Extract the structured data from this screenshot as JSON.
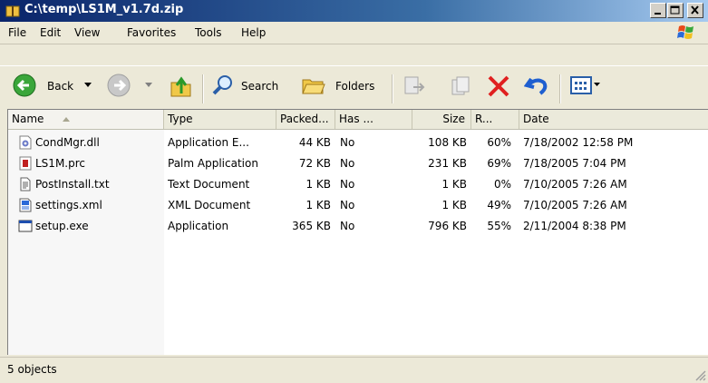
{
  "window": {
    "title": "C:\\temp\\LS1M_v1.7d.zip"
  },
  "menu": [
    "File",
    "Edit",
    "View",
    "Favorites",
    "Tools",
    "Help"
  ],
  "toolbar": {
    "back_label": "Back",
    "search_label": "Search",
    "folders_label": "Folders"
  },
  "columns": [
    "Name",
    "Type",
    "Packed...",
    "Has ...",
    "Size",
    "R...",
    "Date"
  ],
  "files": [
    {
      "name": "CondMgr.dll",
      "type": "Application E...",
      "packed": "44 KB",
      "has": "No",
      "size": "108 KB",
      "ratio": "60%",
      "date": "7/18/2002 12:58 PM",
      "icon": "dll-icon"
    },
    {
      "name": "LS1M.prc",
      "type": "Palm Application",
      "packed": "72 KB",
      "has": "No",
      "size": "231 KB",
      "ratio": "69%",
      "date": "7/18/2005 7:04 PM",
      "icon": "palm-app-icon"
    },
    {
      "name": "PostInstall.txt",
      "type": "Text Document",
      "packed": "1 KB",
      "has": "No",
      "size": "1 KB",
      "ratio": "0%",
      "date": "7/10/2005 7:26 AM",
      "icon": "text-document-icon"
    },
    {
      "name": "settings.xml",
      "type": "XML Document",
      "packed": "1 KB",
      "has": "No",
      "size": "1 KB",
      "ratio": "49%",
      "date": "7/10/2005 7:26 AM",
      "icon": "xml-document-icon"
    },
    {
      "name": "setup.exe",
      "type": "Application",
      "packed": "365 KB",
      "has": "No",
      "size": "796 KB",
      "ratio": "55%",
      "date": "2/11/2004 8:38 PM",
      "icon": "application-icon"
    }
  ],
  "status": {
    "text": "5 objects"
  },
  "colors": {
    "title_start": "#0a246a",
    "title_end": "#a6caf0",
    "delete_red": "#e02020",
    "nav_green": "#2f9a2f"
  }
}
